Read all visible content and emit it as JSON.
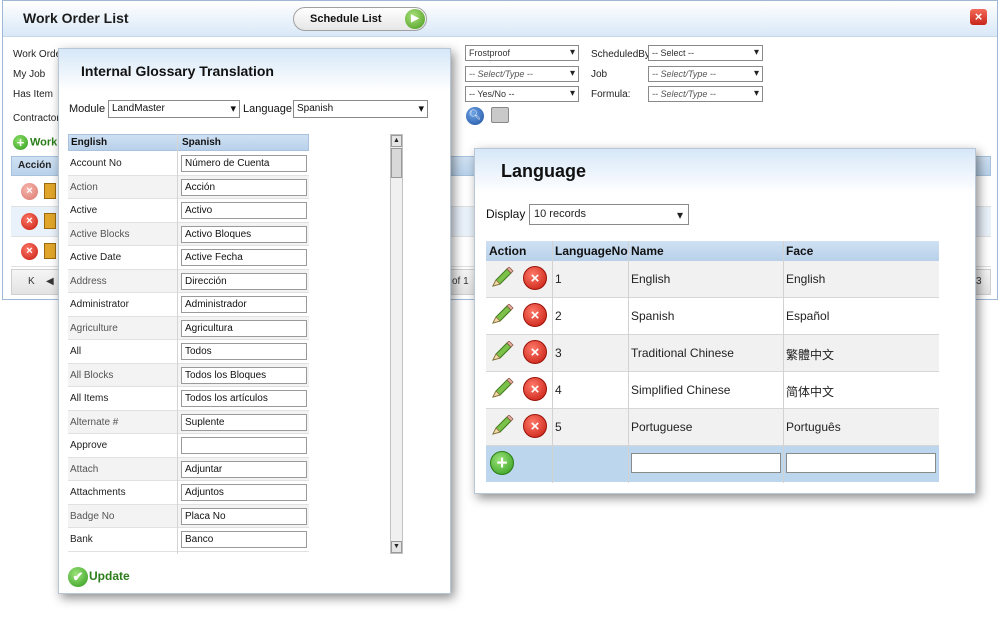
{
  "work_order": {
    "title": "Work Order List",
    "schedule_button": "Schedule List",
    "labels": {
      "work_order": "Work Orde",
      "my_job": "My Job",
      "has_item": "Has Item",
      "contractor": "Contractor",
      "scheduled_by": "ScheduledBy",
      "job": "Job",
      "formula": "Formula:"
    },
    "selects": {
      "frostproof": "Frostproof",
      "select_type_1": "-- Select/Type --",
      "yes_no": "-- Yes/No --",
      "scheduled_by": "-- Select --",
      "job": "-- Select/Type --",
      "formula": "-- Select/Type --"
    },
    "add_label": "Work",
    "grid_header_action": "Acción",
    "pager_first": "K",
    "pager_prev": "◀",
    "pager_of": "of 1",
    "pager_right": "3"
  },
  "glossary": {
    "title": "Internal Glossary Translation",
    "module_label": "Module",
    "module_value": "LandMaster",
    "language_label": "Language",
    "language_value": "Spanish",
    "columns": [
      "English",
      "Spanish"
    ],
    "rows": [
      {
        "en": "Account No",
        "es": "Número de Cuenta"
      },
      {
        "en": "Action",
        "es": "Acción"
      },
      {
        "en": "Active",
        "es": "Activo"
      },
      {
        "en": "Active Blocks",
        "es": "Activo Bloques"
      },
      {
        "en": "Active Date",
        "es": "Active Fecha"
      },
      {
        "en": "Address",
        "es": "Dirección"
      },
      {
        "en": "Administrator",
        "es": "Administrador"
      },
      {
        "en": "Agriculture",
        "es": "Agricultura"
      },
      {
        "en": "All",
        "es": "Todos"
      },
      {
        "en": "All Blocks",
        "es": "Todos los Bloques"
      },
      {
        "en": "All Items",
        "es": "Todos los artículos"
      },
      {
        "en": "Alternate #",
        "es": "Suplente"
      },
      {
        "en": "Approve",
        "es": ""
      },
      {
        "en": "Attach",
        "es": "Adjuntar"
      },
      {
        "en": "Attachments",
        "es": "Adjuntos"
      },
      {
        "en": "Badge No",
        "es": "Placa No"
      },
      {
        "en": "Bank",
        "es": "Banco"
      }
    ],
    "update_label": "Update"
  },
  "language": {
    "title": "Language",
    "display_label": "Display",
    "display_value": "10 records",
    "columns": [
      "Action",
      "LanguageNo",
      "Name",
      "Face"
    ],
    "rows": [
      {
        "no": "1",
        "name": "English",
        "face": "English"
      },
      {
        "no": "2",
        "name": "Spanish",
        "face": "Español"
      },
      {
        "no": "3",
        "name": "Traditional Chinese",
        "face": "繁體中文"
      },
      {
        "no": "4",
        "name": "Simplified Chinese",
        "face": "简体中文"
      },
      {
        "no": "5",
        "name": "Portuguese",
        "face": "Português"
      }
    ]
  },
  "colors": {
    "header_blue": "#cfe1f3",
    "add_green": "#2f9a1a",
    "delete_red": "#c4180c"
  }
}
